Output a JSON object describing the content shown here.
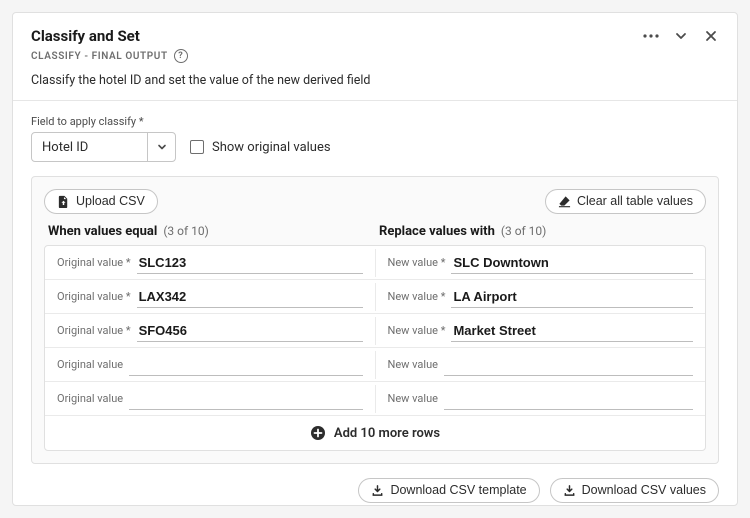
{
  "header": {
    "title": "Classify and Set",
    "subtitle": "CLASSIFY - FINAL OUTPUT",
    "description": "Classify the hotel ID and set the value of the new derived field"
  },
  "field": {
    "label": "Field to apply classify",
    "required_mark": "*",
    "value": "Hotel ID",
    "show_original_label": "Show original values"
  },
  "buttons": {
    "upload": "Upload CSV",
    "clear_all": "Clear all table values",
    "download_template": "Download CSV template",
    "download_values": "Download CSV values",
    "add_more": "Add 10 more rows"
  },
  "columns": {
    "left_title": "When values equal",
    "left_count": "(3 of 10)",
    "right_title": "Replace values with",
    "right_count": "(3 of 10)",
    "left_cell_label": "Original value",
    "right_cell_label": "New value",
    "required_mark": "*"
  },
  "rows": [
    {
      "original": "SLC123",
      "replacement": "SLC Downtown",
      "required": true
    },
    {
      "original": "LAX342",
      "replacement": "LA Airport",
      "required": true
    },
    {
      "original": "SFO456",
      "replacement": "Market Street",
      "required": true
    },
    {
      "original": "",
      "replacement": "",
      "required": false
    },
    {
      "original": "",
      "replacement": "",
      "required": false
    }
  ]
}
